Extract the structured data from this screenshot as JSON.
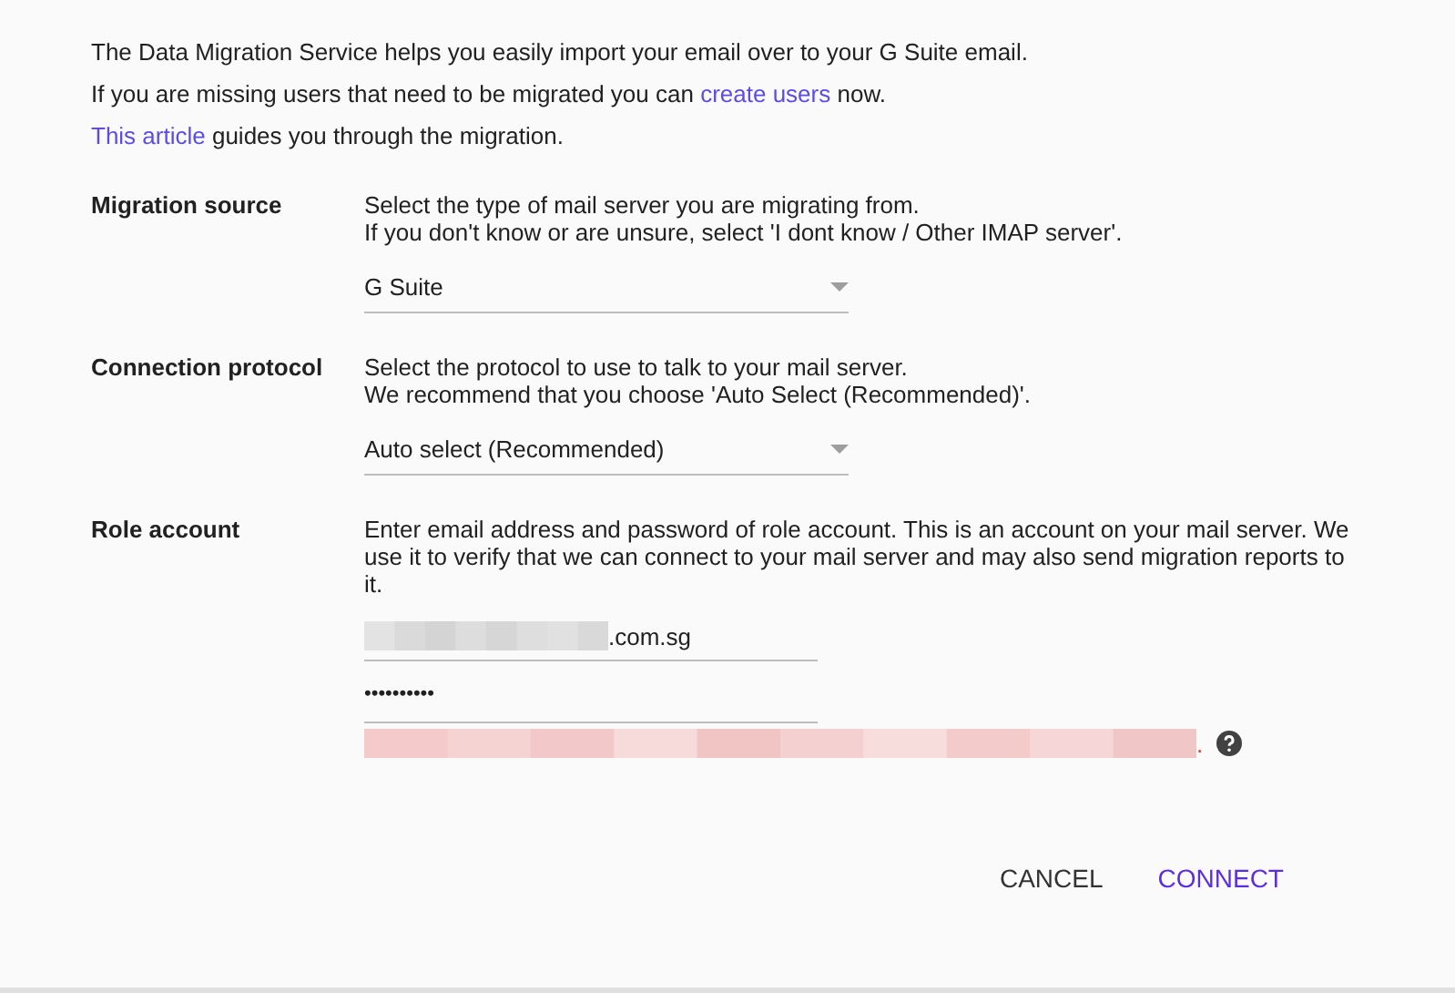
{
  "intro": [
    {
      "parts": [
        {
          "text": "The Data Migration Service helps you easily import your email over to your G Suite email.",
          "kind": "text"
        }
      ]
    },
    {
      "parts": [
        {
          "text": "If you are missing users that need to be migrated you can ",
          "kind": "text"
        },
        {
          "text": "create users",
          "kind": "link"
        },
        {
          "text": " now.",
          "kind": "text"
        }
      ]
    },
    {
      "parts": [
        {
          "text": "This article",
          "kind": "link"
        },
        {
          "text": " guides you through the migration.",
          "kind": "text"
        }
      ]
    }
  ],
  "sections": [
    {
      "label": "Migration source",
      "description": [
        "Select the type of mail server you are migrating from.",
        "If you don't know or are unsure, select 'I dont know / Other IMAP server'."
      ],
      "kind": "dropdown",
      "value": "G Suite"
    },
    {
      "label": "Connection protocol",
      "description": [
        "Select the protocol to use to talk to your mail server.",
        "We recommend that you choose 'Auto Select (Recommended)'."
      ],
      "kind": "dropdown",
      "value": "Auto select (Recommended)"
    },
    {
      "label": "Role account",
      "description": [
        "Enter email address and password of role account. This is an account on your mail server. We use it to verify that we can connect to your mail server and may also send migration reports to it."
      ],
      "kind": "credentials",
      "email_value": ".com.sg",
      "password_value": "••••••••••",
      "error_tail": "."
    }
  ],
  "buttons": [
    {
      "label": "CANCEL",
      "kind": "secondary"
    },
    {
      "label": "CONNECT",
      "kind": "primary"
    }
  ]
}
